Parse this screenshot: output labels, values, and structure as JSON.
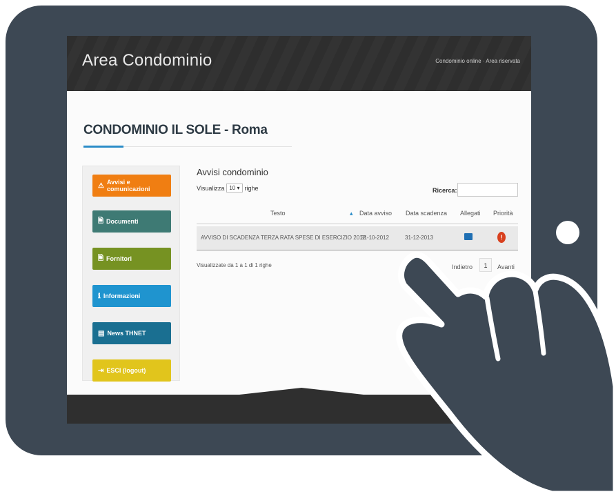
{
  "header": {
    "brand": "Area Condominio",
    "links": "Condominio online · Area riservata"
  },
  "page": {
    "title": "CONDOMINIO IL SOLE - Roma"
  },
  "sidebar": {
    "items": [
      {
        "label": "Avvisi e comunicazioni",
        "icon": "warning-icon",
        "color": "#f07e12"
      },
      {
        "label": "Documenti",
        "icon": "document-icon",
        "color": "#3e7a74"
      },
      {
        "label": "Fornitori",
        "icon": "document-icon",
        "color": "#769222"
      },
      {
        "label": "Informazioni",
        "icon": "info-icon",
        "color": "#1f94cf"
      },
      {
        "label": "News THNET",
        "icon": "news-icon",
        "color": "#1a6f91"
      },
      {
        "label": "ESCI (logout)",
        "icon": "logout-icon",
        "color": "#e1c51c"
      }
    ]
  },
  "table": {
    "title": "Avvisi condominio",
    "show_prefix": "Visualizza",
    "show_value": "10",
    "show_suffix": "righe",
    "search_label": "Ricerca:",
    "search_value": "",
    "columns": [
      "Testo",
      "Data avviso",
      "Data scadenza",
      "Allegati",
      "Priorità"
    ],
    "rows": [
      {
        "testo": "AVVISO DI SCADENZA TERZA RATA SPESE DI ESERCIZIO 2012",
        "data_avviso": "31-10-2012",
        "data_scadenza": "31-12-2013"
      }
    ],
    "info": "Visualizzate da 1 a 1 di 1 righe",
    "pager": {
      "prev": "Indietro",
      "page": "1",
      "next": "Avanti"
    }
  }
}
